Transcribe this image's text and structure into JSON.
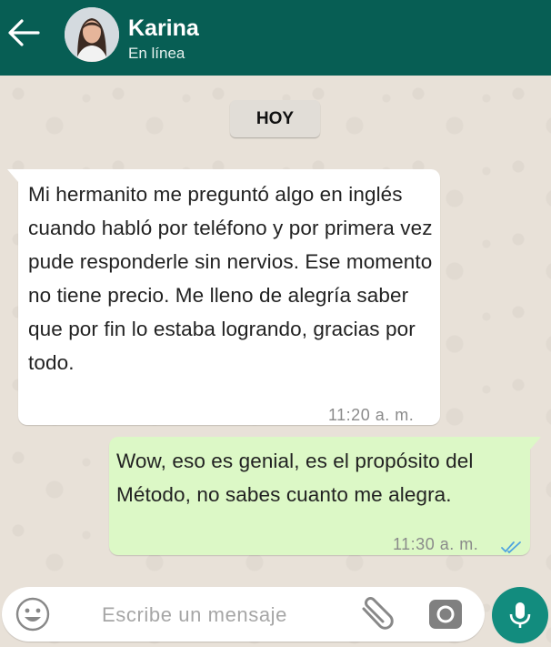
{
  "header": {
    "contact_name": "Karina",
    "status": "En línea",
    "background": "#075e54",
    "back_icon": "arrow-left-icon",
    "avatar": "contact-avatar-photo"
  },
  "chat": {
    "date_label": "HOY",
    "messages": [
      {
        "direction": "incoming",
        "text": "Mi hermanito me preguntó algo en inglés cuando habló por teléfono y por primera vez pude responderle sin nervios. Ese momento no tiene precio. Me lleno de alegría saber que por fin lo estaba logrando, gracias por todo.",
        "time": "11:20 a. m.",
        "bubble_color": "#ffffff"
      },
      {
        "direction": "outgoing",
        "text": "Wow, eso es genial, es el propósito del Método, no sabes cuanto me alegra.",
        "time": "11:30 a. m.",
        "status_icon": "double-check-read-icon",
        "bubble_color": "#dcf8c6"
      }
    ]
  },
  "composer": {
    "placeholder": "Escribe un mensaje",
    "emoji_icon": "emoji-icon",
    "attach_icon": "paperclip-icon",
    "camera_icon": "camera-icon",
    "mic_icon": "microphone-icon",
    "mic_button_color": "#128c7e"
  }
}
